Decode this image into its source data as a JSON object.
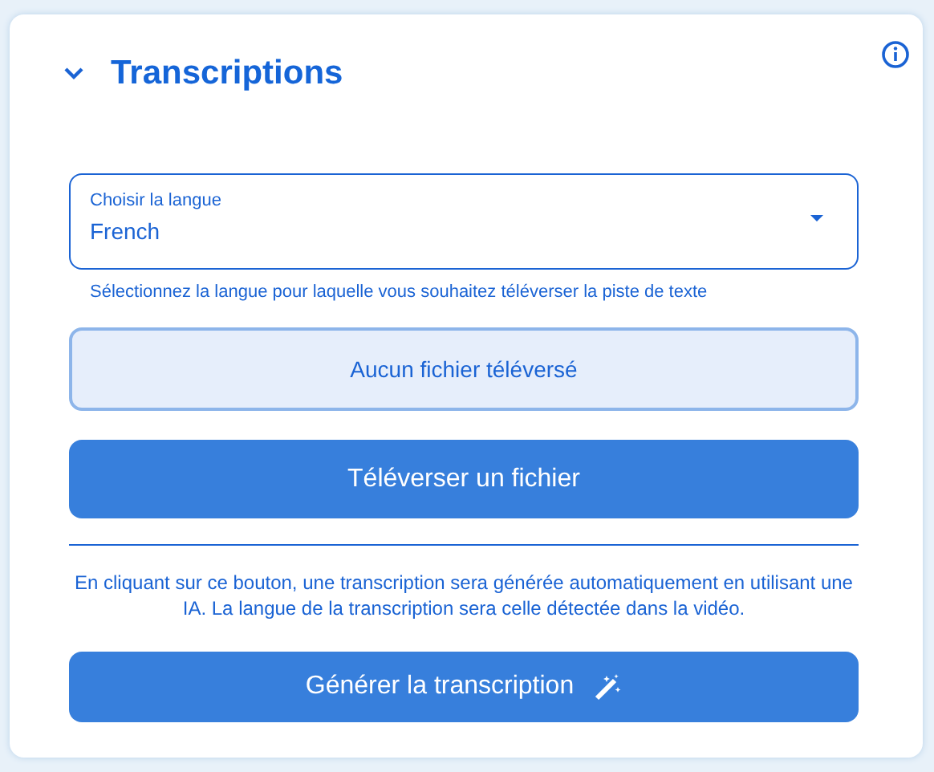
{
  "panel": {
    "title": "Transcriptions",
    "expanded": true
  },
  "language_select": {
    "label": "Choisir la langue",
    "value": "French",
    "helper": "Sélectionnez la langue pour laquelle vous souhaitez téléverser la piste de texte"
  },
  "file_status": "Aucun fichier téléversé",
  "upload_button": "Téléverser un fichier",
  "ai_notice": "En cliquant sur ce bouton, une transcription sera générée automatiquement en utilisant une IA. La langue de la transcription sera celle détectée dans la vidéo.",
  "generate_button": "Générer la transcription"
}
